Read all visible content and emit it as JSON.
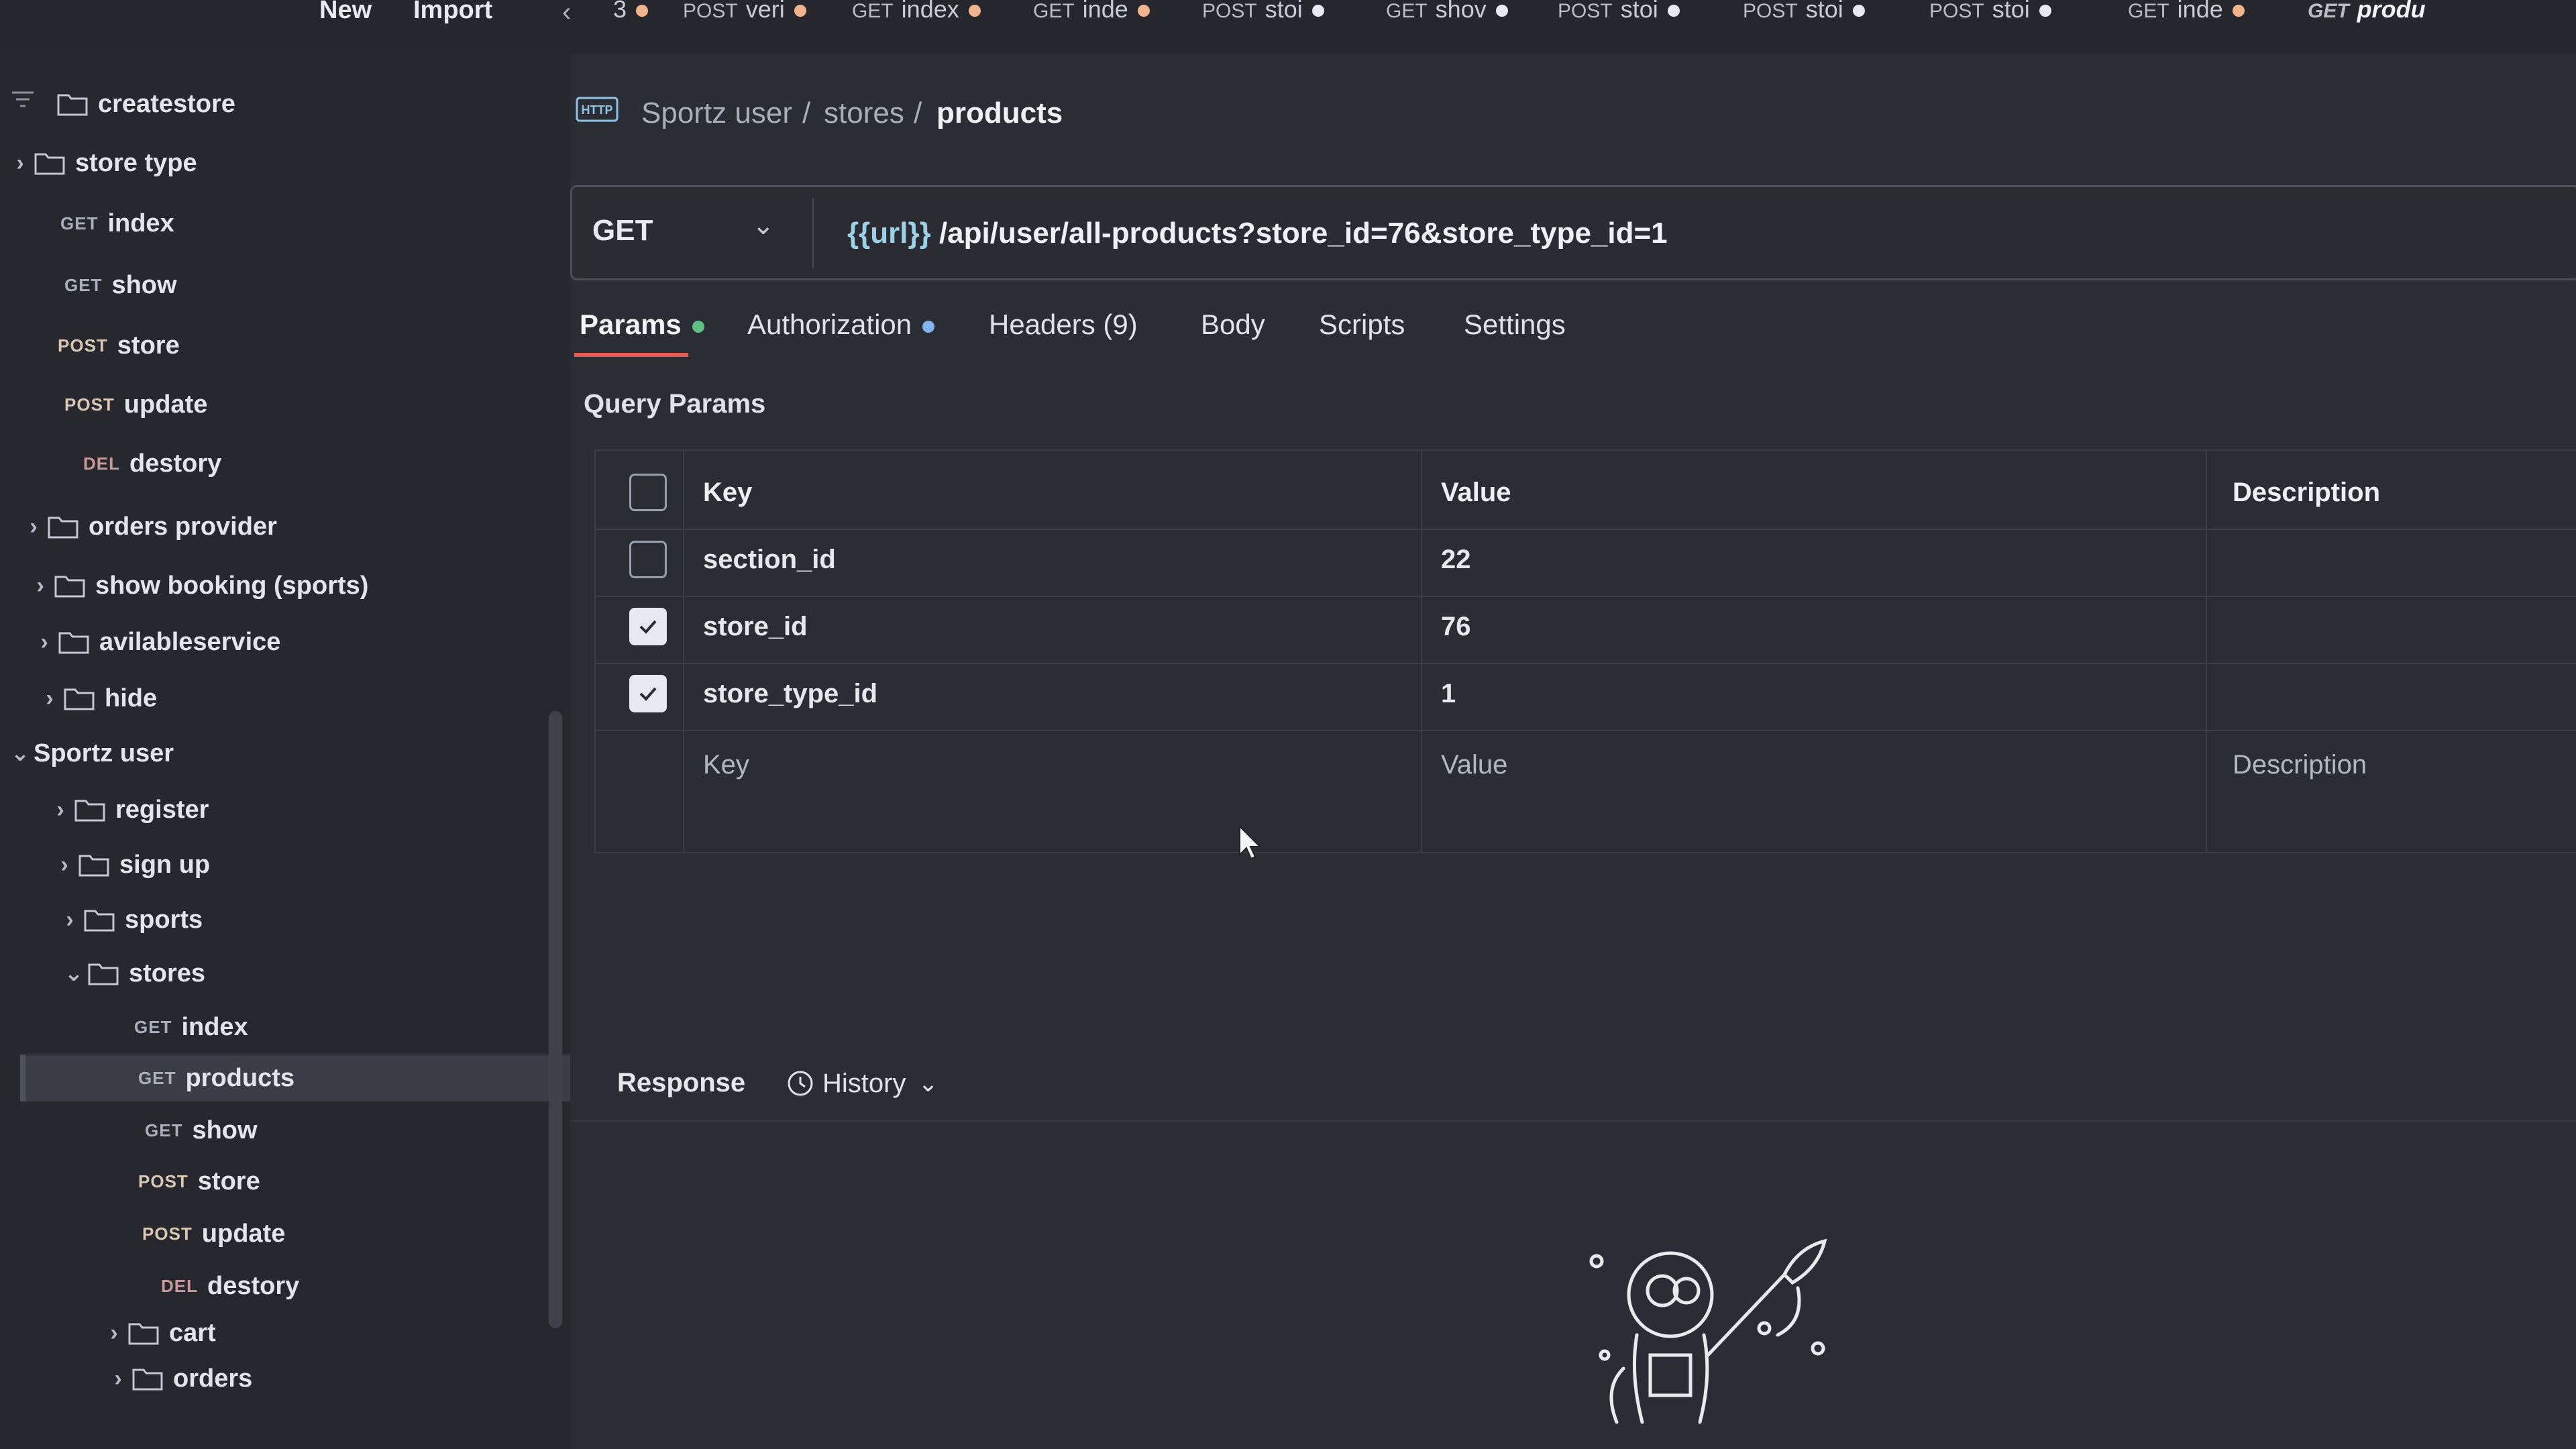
{
  "top_bar": {
    "new_label": "New",
    "import_label": "Import",
    "back_arrow": "‹",
    "overflow_count": "3",
    "tabs": [
      {
        "method": "POST",
        "label": "veri",
        "dot": "orange"
      },
      {
        "method": "GET",
        "label": "index",
        "dot": "orange"
      },
      {
        "method": "GET",
        "label": "inde",
        "dot": "orange"
      },
      {
        "method": "POST",
        "label": "stoi",
        "dot": "white"
      },
      {
        "method": "GET",
        "label": "shov",
        "dot": "white"
      },
      {
        "method": "POST",
        "label": "stoi",
        "dot": "white"
      },
      {
        "method": "POST",
        "label": "stoi",
        "dot": "white"
      },
      {
        "method": "POST",
        "label": "stoi",
        "dot": "white"
      },
      {
        "method": "GET",
        "label": "inde",
        "dot": "orange"
      },
      {
        "method": "GET",
        "label": "produ",
        "dot": "none",
        "active": true
      }
    ]
  },
  "sidebar": {
    "items": [
      {
        "type": "folder",
        "label": "createstore",
        "chevron": ""
      },
      {
        "type": "folder",
        "label": "store type",
        "chevron": "›"
      },
      {
        "type": "request",
        "method": "GET",
        "label": "index"
      },
      {
        "type": "request",
        "method": "GET",
        "label": "show"
      },
      {
        "type": "request",
        "method": "POST",
        "label": "store"
      },
      {
        "type": "request",
        "method": "POST",
        "label": "update"
      },
      {
        "type": "request",
        "method": "DEL",
        "label": "destory"
      },
      {
        "type": "folder",
        "label": "orders provider",
        "chevron": "›"
      },
      {
        "type": "folder",
        "label": "show booking (sports)",
        "chevron": "›"
      },
      {
        "type": "folder",
        "label": "avilableservice",
        "chevron": "›"
      },
      {
        "type": "folder",
        "label": "hide",
        "chevron": "›"
      },
      {
        "type": "collection",
        "label": "Sportz user",
        "chevron": "⌄"
      },
      {
        "type": "folder",
        "label": "register",
        "chevron": "›"
      },
      {
        "type": "folder",
        "label": "sign up",
        "chevron": "›"
      },
      {
        "type": "folder",
        "label": "sports",
        "chevron": "›"
      },
      {
        "type": "folder",
        "label": "stores",
        "chevron": "⌄"
      },
      {
        "type": "request",
        "method": "GET",
        "label": "index"
      },
      {
        "type": "request",
        "method": "GET",
        "label": "products",
        "selected": true
      },
      {
        "type": "request",
        "method": "GET",
        "label": "show"
      },
      {
        "type": "request",
        "method": "POST",
        "label": "store"
      },
      {
        "type": "request",
        "method": "POST",
        "label": "update"
      },
      {
        "type": "request",
        "method": "DEL",
        "label": "destory"
      },
      {
        "type": "folder",
        "label": "cart",
        "chevron": "›"
      },
      {
        "type": "folder",
        "label": "orders",
        "chevron": "›"
      }
    ]
  },
  "breadcrumb": {
    "parts": [
      "Sportz user",
      "stores"
    ],
    "current": "products",
    "separator": "/"
  },
  "request": {
    "method": "GET",
    "url_var": "{{url}}",
    "url_path": " /api/user/all-products?store_id=76&store_type_id=1"
  },
  "param_tabs": [
    {
      "label": "Params",
      "dot": "green",
      "active": true
    },
    {
      "label": "Authorization",
      "dot": "blue"
    },
    {
      "label": "Headers (9)"
    },
    {
      "label": "Body"
    },
    {
      "label": "Scripts"
    },
    {
      "label": "Settings"
    }
  ],
  "query_params": {
    "title": "Query Params",
    "headers": [
      "Key",
      "Value",
      "Description"
    ],
    "rows": [
      {
        "checked": false,
        "key": "section_id",
        "value": "22",
        "description": ""
      },
      {
        "checked": true,
        "key": "store_id",
        "value": "76",
        "description": ""
      },
      {
        "checked": true,
        "key": "store_type_id",
        "value": "1",
        "description": ""
      }
    ],
    "placeholders": {
      "key": "Key",
      "value": "Value",
      "description": "Description"
    }
  },
  "response": {
    "tab_label": "Response",
    "history_label": "History"
  },
  "colors": {
    "accent": "#e85a4f",
    "params_dot": "#5fbf83",
    "auth_dot": "#7fb6f0"
  }
}
